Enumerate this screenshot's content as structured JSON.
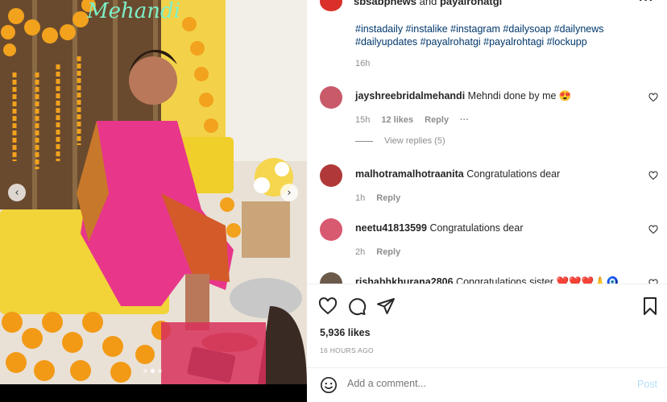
{
  "header": {
    "username": "sbsabpnews",
    "and_text": " and ",
    "coauthor": "payalrohatgi",
    "more_icon": "more-horizontal-icon"
  },
  "photo": {
    "sign_text": "Mehandi",
    "prev_icon": "chevron-left-icon",
    "next_icon": "chevron-right-icon"
  },
  "caption": {
    "tags": "#instadaily #instalike #instagram #dailysoap #dailynews #dailyupdates #payalrohatgi #payalrohtagi #lockupp",
    "time": "16h"
  },
  "comments": [
    {
      "user": "jayshreebridalmehandi",
      "text": "Mehndi done by me 😍",
      "time": "15h",
      "likes": "12 likes",
      "reply": "Reply",
      "more": "···",
      "avatar_color": "#c95a6a"
    },
    {
      "user": "malhotramalhotraanita",
      "text": "Congratulations dear",
      "time": "1h",
      "reply": "Reply",
      "avatar_color": "#b03838"
    },
    {
      "user": "neetu41813599",
      "text": "Congratulations dear",
      "time": "2h",
      "reply": "Reply",
      "avatar_color": "#d85a70"
    },
    {
      "user": "rishabhkhurana2806",
      "text": "Congratulations sister ❤️❤️❤️🙏🧿",
      "avatar_color": "#6b5a4a"
    }
  ],
  "view_replies": "View replies (5)",
  "stats": {
    "likes": "5,936 likes",
    "posted": "16 HOURS AGO"
  },
  "add_comment": {
    "placeholder": "Add a comment...",
    "post_label": "Post"
  },
  "colors": {
    "hashtag": "#00376b",
    "muted": "#8e8e8e",
    "post_disabled": "#b2dffc"
  }
}
